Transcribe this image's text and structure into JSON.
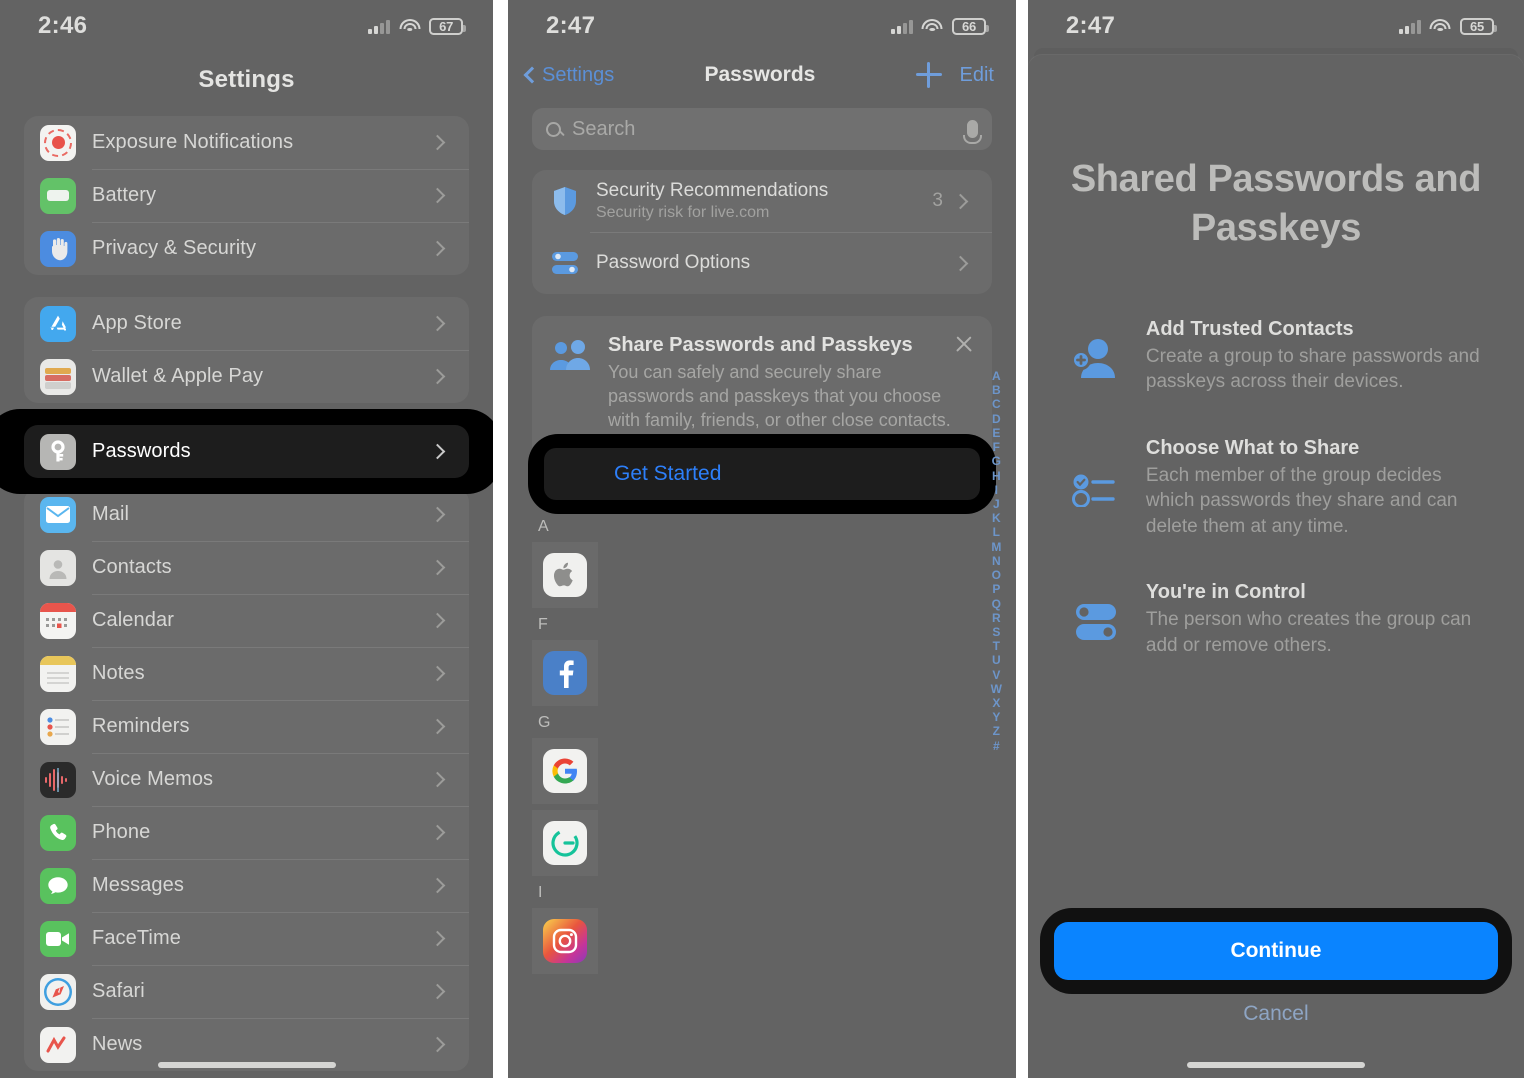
{
  "panel1": {
    "status": {
      "time": "2:46",
      "battery": "67",
      "signal_icon": "cellular-bars-icon",
      "wifi_icon": "wifi-icon"
    },
    "nav_title": "Settings",
    "groups": [
      {
        "items": [
          {
            "label": "Exposure Notifications",
            "icon": "exposure-notifications-icon"
          },
          {
            "label": "Battery",
            "icon": "battery-icon"
          },
          {
            "label": "Privacy & Security",
            "icon": "privacy-security-icon"
          }
        ]
      },
      {
        "items": [
          {
            "label": "App Store",
            "icon": "app-store-icon"
          },
          {
            "label": "Wallet & Apple Pay",
            "icon": "wallet-icon"
          }
        ]
      }
    ],
    "highlighted": {
      "label": "Passwords",
      "icon": "passwords-key-icon"
    },
    "group3": {
      "items": [
        {
          "label": "Mail",
          "icon": "mail-icon"
        },
        {
          "label": "Contacts",
          "icon": "contacts-icon"
        },
        {
          "label": "Calendar",
          "icon": "calendar-icon"
        },
        {
          "label": "Notes",
          "icon": "notes-icon"
        },
        {
          "label": "Reminders",
          "icon": "reminders-icon"
        },
        {
          "label": "Voice Memos",
          "icon": "voice-memos-icon"
        },
        {
          "label": "Phone",
          "icon": "phone-icon"
        },
        {
          "label": "Messages",
          "icon": "messages-icon"
        },
        {
          "label": "FaceTime",
          "icon": "facetime-icon"
        },
        {
          "label": "Safari",
          "icon": "safari-icon"
        },
        {
          "label": "News",
          "icon": "news-icon"
        }
      ]
    }
  },
  "panel2": {
    "status": {
      "time": "2:47",
      "battery": "66"
    },
    "nav": {
      "back_label": "Settings",
      "title": "Passwords",
      "add_label": "+",
      "edit_label": "Edit"
    },
    "search": {
      "placeholder": "Search",
      "value": ""
    },
    "options": [
      {
        "title": "Security Recommendations",
        "subtitle": "Security risk for live.com",
        "count": "3",
        "icon": "shield-icon"
      },
      {
        "title": "Password Options",
        "subtitle": "",
        "count": "",
        "icon": "sliders-icon"
      }
    ],
    "promo": {
      "heading": "Share Passwords and Passkeys",
      "body": "You can safely and securely share passwords and passkeys that you choose with family, friends, or other close contacts.",
      "button_label": "Get Started",
      "close_icon": "close-icon",
      "icon": "two-people-icon"
    },
    "sections": [
      {
        "letter": "A",
        "apps": [
          {
            "name": "apple-icon"
          }
        ]
      },
      {
        "letter": "F",
        "apps": [
          {
            "name": "facebook-icon"
          }
        ]
      },
      {
        "letter": "G",
        "apps": [
          {
            "name": "google-icon"
          },
          {
            "name": "grammarly-icon"
          }
        ]
      },
      {
        "letter": "I",
        "apps": [
          {
            "name": "instagram-icon"
          }
        ]
      }
    ],
    "alphabet_index": [
      "A",
      "B",
      "C",
      "D",
      "E",
      "F",
      "G",
      "H",
      "I",
      "J",
      "K",
      "L",
      "M",
      "N",
      "O",
      "P",
      "Q",
      "R",
      "S",
      "T",
      "U",
      "V",
      "W",
      "X",
      "Y",
      "Z",
      "#"
    ]
  },
  "panel3": {
    "status": {
      "time": "2:47",
      "battery": "65"
    },
    "title": "Shared Passwords and Passkeys",
    "features": [
      {
        "heading": "Add Trusted Contacts",
        "body": "Create a group to share passwords and passkeys across their devices.",
        "icon": "person-add-icon"
      },
      {
        "heading": "Choose What to Share",
        "body": "Each member of the group decides which passwords they share and can delete them at any time.",
        "icon": "checklist-icon"
      },
      {
        "heading": "You're in Control",
        "body": "The person who creates the group can add or remove others.",
        "icon": "toggles-icon"
      }
    ],
    "continue_label": "Continue",
    "cancel_label": "Cancel"
  },
  "colors": {
    "accent_blue": "#0a84ff",
    "link_blue": "#2d7ff9",
    "background": "#636363",
    "highlight_black": "#000000"
  }
}
